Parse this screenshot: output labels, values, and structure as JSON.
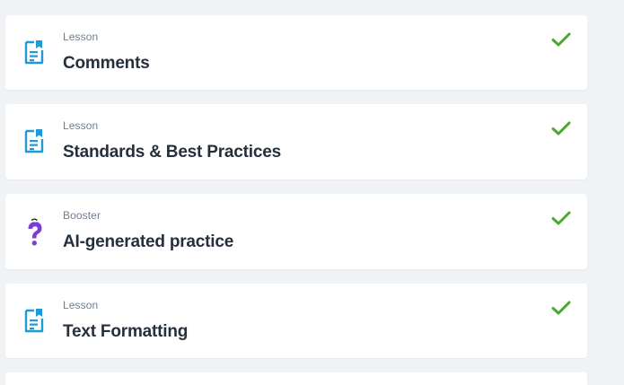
{
  "colors": {
    "page_background": "#f0f3f6",
    "card_background": "#ffffff",
    "lesson_icon": "#1f9ad9",
    "booster_icon": "#7a3fcf",
    "check": "#4aa92c",
    "kind_text": "#6f7e92",
    "title_text": "#26303d"
  },
  "items": [
    {
      "kind": "Lesson",
      "title": "Comments",
      "icon": "document-icon",
      "completed": true
    },
    {
      "kind": "Lesson",
      "title": "Standards & Best Practices",
      "icon": "document-icon",
      "completed": true
    },
    {
      "kind": "Booster",
      "title": "AI-generated practice",
      "icon": "question-character-icon",
      "completed": true
    },
    {
      "kind": "Lesson",
      "title": "Text Formatting",
      "icon": "document-icon",
      "completed": true
    }
  ]
}
